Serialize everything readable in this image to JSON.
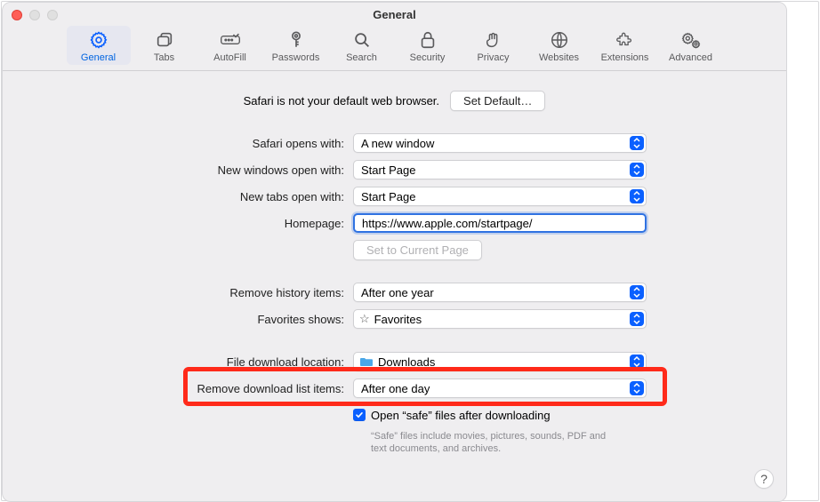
{
  "window": {
    "title": "General"
  },
  "toolbar": {
    "items": [
      {
        "id": "general",
        "label": "General"
      },
      {
        "id": "tabs",
        "label": "Tabs"
      },
      {
        "id": "autofill",
        "label": "AutoFill"
      },
      {
        "id": "passwords",
        "label": "Passwords"
      },
      {
        "id": "search",
        "label": "Search"
      },
      {
        "id": "security",
        "label": "Security"
      },
      {
        "id": "privacy",
        "label": "Privacy"
      },
      {
        "id": "websites",
        "label": "Websites"
      },
      {
        "id": "extensions",
        "label": "Extensions"
      },
      {
        "id": "advanced",
        "label": "Advanced"
      }
    ]
  },
  "default_browser": {
    "message": "Safari is not your default web browser.",
    "button": "Set Default…"
  },
  "fields": {
    "opens_with": {
      "label": "Safari opens with:",
      "value": "A new window"
    },
    "new_windows": {
      "label": "New windows open with:",
      "value": "Start Page"
    },
    "new_tabs": {
      "label": "New tabs open with:",
      "value": "Start Page"
    },
    "homepage": {
      "label": "Homepage:",
      "value": "https://www.apple.com/startpage/",
      "button": "Set to Current Page"
    },
    "remove_history": {
      "label": "Remove history items:",
      "value": "After one year"
    },
    "favorites_shows": {
      "label": "Favorites shows:",
      "value": "Favorites"
    },
    "download_location": {
      "label": "File download location:",
      "value": "Downloads"
    },
    "remove_downloads": {
      "label": "Remove download list items:",
      "value": "After one day"
    },
    "open_safe": {
      "label": "Open “safe” files after downloading",
      "note": "“Safe” files include movies, pictures, sounds,\nPDF and text documents, and archives."
    }
  }
}
